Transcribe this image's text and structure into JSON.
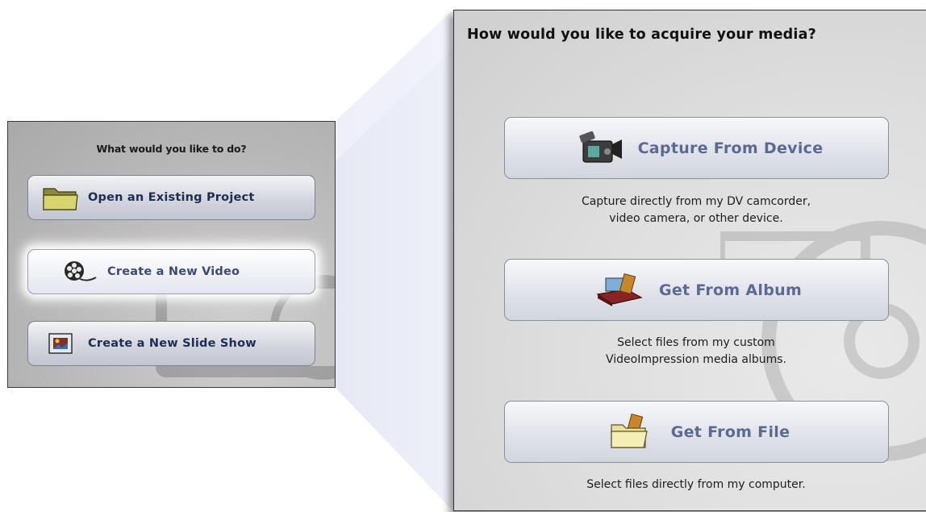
{
  "left_panel": {
    "title": "What would you like to do?",
    "buttons": [
      {
        "label": "Open an Existing Project",
        "icon": "folder-icon"
      },
      {
        "label": "Create a New Video",
        "icon": "film-reel-icon"
      },
      {
        "label": "Create a New Slide Show",
        "icon": "slide-icon"
      }
    ]
  },
  "right_panel": {
    "title": "How would you like to acquire your media?",
    "options": [
      {
        "label": "Capture From Device",
        "icon": "camcorder-icon",
        "desc_line1": "Capture directly from my DV camcorder,",
        "desc_line2": "video camera, or other device."
      },
      {
        "label": "Get From Album",
        "icon": "album-icon",
        "desc_line1": "Select files from my custom",
        "desc_line2": "VideoImpression media albums."
      },
      {
        "label": "Get From File",
        "icon": "file-folder-icon",
        "desc_line1": "Select files directly from my computer.",
        "desc_line2": ""
      }
    ]
  }
}
